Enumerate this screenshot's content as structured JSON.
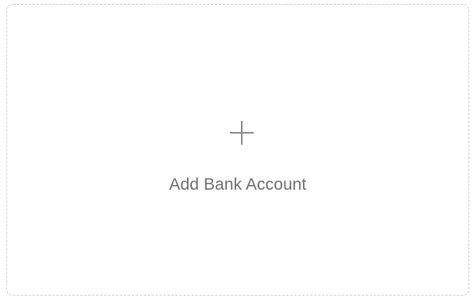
{
  "add_account_card": {
    "icon": "plus-icon",
    "label": "Add Bank Account"
  },
  "colors": {
    "border": "#c9c9c9",
    "icon": "#8a8a8a",
    "label": "#6d6d6d",
    "background": "#ffffff"
  }
}
